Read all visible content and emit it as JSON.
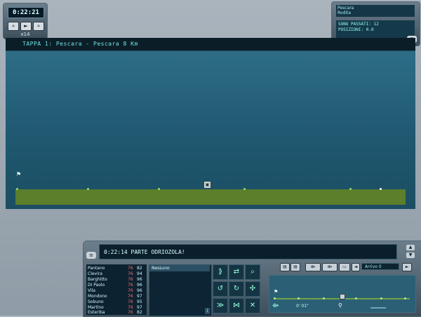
{
  "clock": {
    "time": "0:22:21",
    "speed_label": "x14",
    "buttons": [
      "«",
      "►",
      "»"
    ]
  },
  "info": {
    "location": "Pescara",
    "sublocation": "Rodita",
    "message_line1": "SONO PASSATI: 12",
    "message_line2": "POSIZIONI: 0.0",
    "arrow_icon": "chevron-down-icon"
  },
  "stage": {
    "title": "TAPPA 1: Pescara - Pescara     8 Km"
  },
  "console": {
    "message": "0:22:14    PARTE ODRIOZOLA!",
    "riders": [
      {
        "name": "Pantano",
        "v1": "76",
        "v2": "82"
      },
      {
        "name": "Clevira",
        "v1": "76",
        "v2": "94"
      },
      {
        "name": "Barghitto",
        "v1": "76",
        "v2": "96"
      },
      {
        "name": "Di Paolo",
        "v1": "76",
        "v2": "96"
      },
      {
        "name": "Vila",
        "v1": "76",
        "v2": "96"
      },
      {
        "name": "Mondono",
        "v1": "76",
        "v2": "97"
      },
      {
        "name": "Sobuno",
        "v1": "76",
        "v2": "95"
      },
      {
        "name": "Martino",
        "v1": "76",
        "v2": "97"
      },
      {
        "name": "Esteriba",
        "v1": "76",
        "v2": "82"
      }
    ],
    "team_selected": "Nessuno",
    "team_info": "i",
    "arrivo": "Arrivo 0",
    "mini_time": "0' 01\""
  },
  "colors": {
    "accent": "#6fe0e0",
    "road": "#5b7f2a",
    "sky": "#2e6d86"
  }
}
